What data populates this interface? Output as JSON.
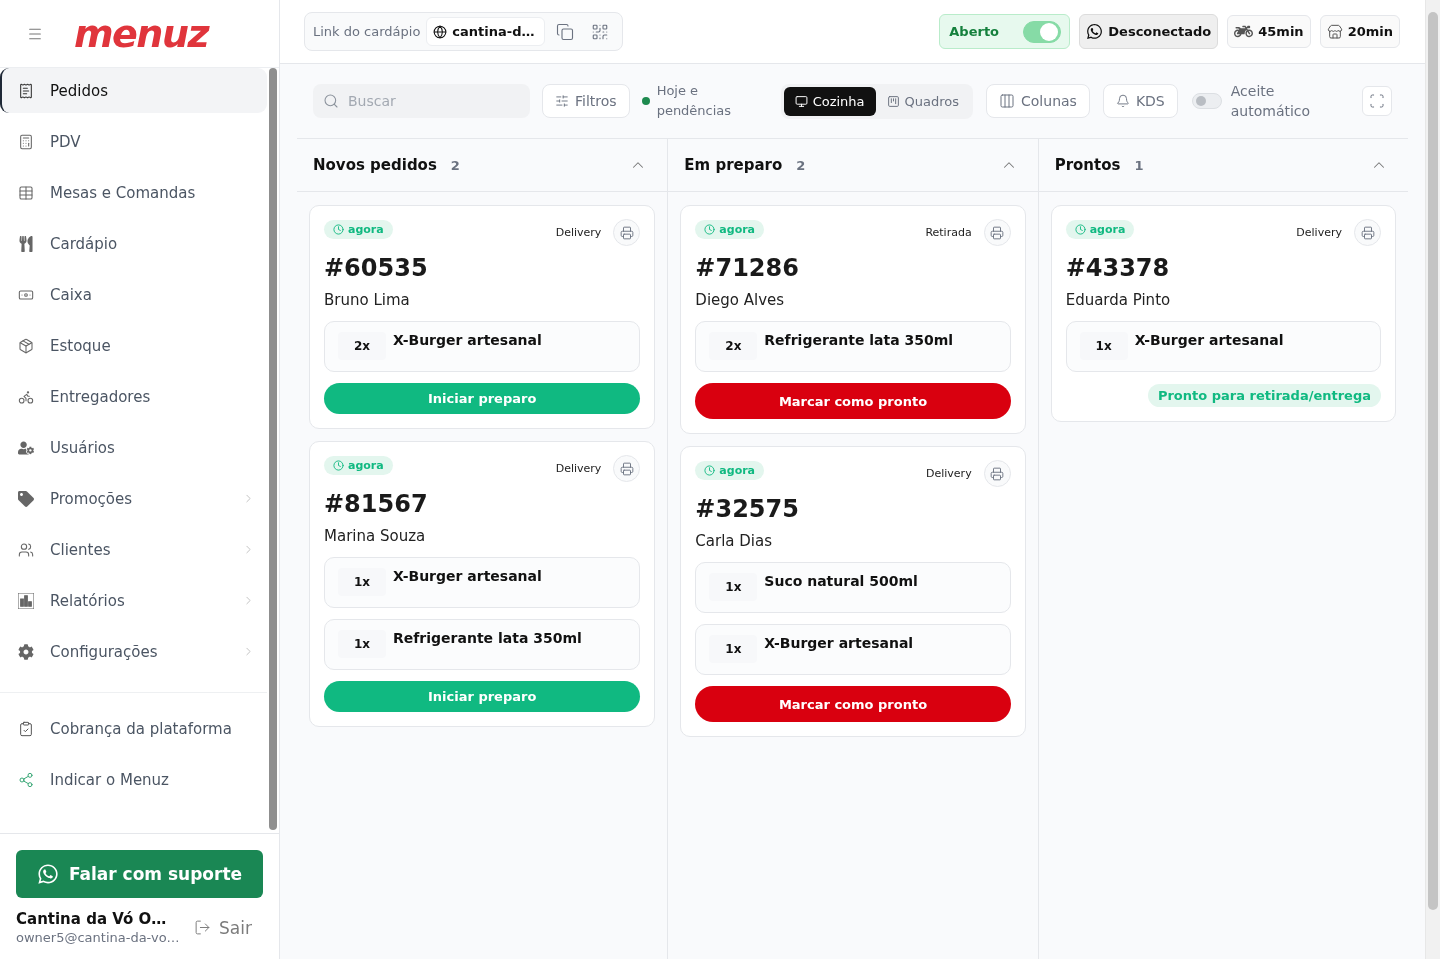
{
  "sidebar": {
    "logo": "menuz",
    "nav_items": [
      {
        "label": "Pedidos",
        "selected": true,
        "has_submenu": false
      },
      {
        "label": "PDV",
        "selected": false,
        "has_submenu": false
      },
      {
        "label": "Mesas e Comandas",
        "selected": false,
        "has_submenu": false
      },
      {
        "label": "Cardápio",
        "selected": false,
        "has_submenu": false
      },
      {
        "label": "Caixa",
        "selected": false,
        "has_submenu": false
      },
      {
        "label": "Estoque",
        "selected": false,
        "has_submenu": false
      },
      {
        "label": "Entregadores",
        "selected": false,
        "has_submenu": false
      },
      {
        "label": "Usuários",
        "selected": false,
        "has_submenu": false
      },
      {
        "label": "Promoções",
        "selected": false,
        "has_submenu": true
      },
      {
        "label": "Clientes",
        "selected": false,
        "has_submenu": true
      },
      {
        "label": "Relatórios",
        "selected": false,
        "has_submenu": true
      },
      {
        "label": "Configurações",
        "selected": false,
        "has_submenu": true
      }
    ],
    "footer_links": [
      {
        "label": "Cobrança da plataforma"
      },
      {
        "label": "Indicar o Menuz"
      }
    ],
    "support_button": "Falar com suporte",
    "account": {
      "name": "Cantina da Vó O…",
      "email": "owner5@cantina-da-vo…",
      "logout": "Sair"
    }
  },
  "top_bar": {
    "menu_link": {
      "label": "Link do cardápio",
      "value": "cantina-d…"
    },
    "store_status": {
      "label": "Aberto",
      "on": true
    },
    "whatsapp_status": "Desconectado",
    "delivery_time": "45min",
    "pickup_time": "20min"
  },
  "toolbar": {
    "search": {
      "placeholder": "Buscar"
    },
    "filters": "Filtros",
    "period": "Hoje e pendências",
    "view_modes": [
      {
        "label": "Cozinha",
        "selected": true
      },
      {
        "label": "Quadros",
        "selected": false
      }
    ],
    "columns_button": "Colunas",
    "kds_button": "KDS",
    "auto_accept": {
      "label": "Aceite automático",
      "on": false
    }
  },
  "columns": [
    {
      "title": "Novos pedidos",
      "count": "2",
      "expanded": true,
      "orders": [
        {
          "time": "agora",
          "type": "Delivery",
          "number": "#60535",
          "customer": "Bruno Lima",
          "items": [
            {
              "qty": "2x",
              "name": "X-Burger artesanal"
            }
          ],
          "action": {
            "kind": "start",
            "label": "Iniciar preparo"
          }
        },
        {
          "time": "agora",
          "type": "Delivery",
          "number": "#81567",
          "customer": "Marina Souza",
          "items": [
            {
              "qty": "1x",
              "name": "X-Burger artesanal"
            },
            {
              "qty": "1x",
              "name": "Refrigerante lata 350ml"
            }
          ],
          "action": {
            "kind": "start",
            "label": "Iniciar preparo"
          }
        }
      ]
    },
    {
      "title": "Em preparo",
      "count": "2",
      "expanded": true,
      "orders": [
        {
          "time": "agora",
          "type": "Retirada",
          "number": "#71286",
          "customer": "Diego Alves",
          "items": [
            {
              "qty": "2x",
              "name": "Refrigerante lata 350ml"
            }
          ],
          "action": {
            "kind": "ready",
            "label": "Marcar como pronto"
          }
        },
        {
          "time": "agora",
          "type": "Delivery",
          "number": "#32575",
          "customer": "Carla Dias",
          "items": [
            {
              "qty": "1x",
              "name": "Suco natural 500ml"
            },
            {
              "qty": "1x",
              "name": "X-Burger artesanal"
            }
          ],
          "action": {
            "kind": "ready",
            "label": "Marcar como pronto"
          }
        }
      ]
    },
    {
      "title": "Prontos",
      "count": "1",
      "expanded": true,
      "orders": [
        {
          "time": "agora",
          "type": "Delivery",
          "number": "#43378",
          "customer": "Eduarda Pinto",
          "items": [
            {
              "qty": "1x",
              "name": "X-Burger artesanal"
            }
          ],
          "action": {
            "kind": "done",
            "label": "Pronto para retirada/entrega"
          }
        }
      ]
    }
  ]
}
